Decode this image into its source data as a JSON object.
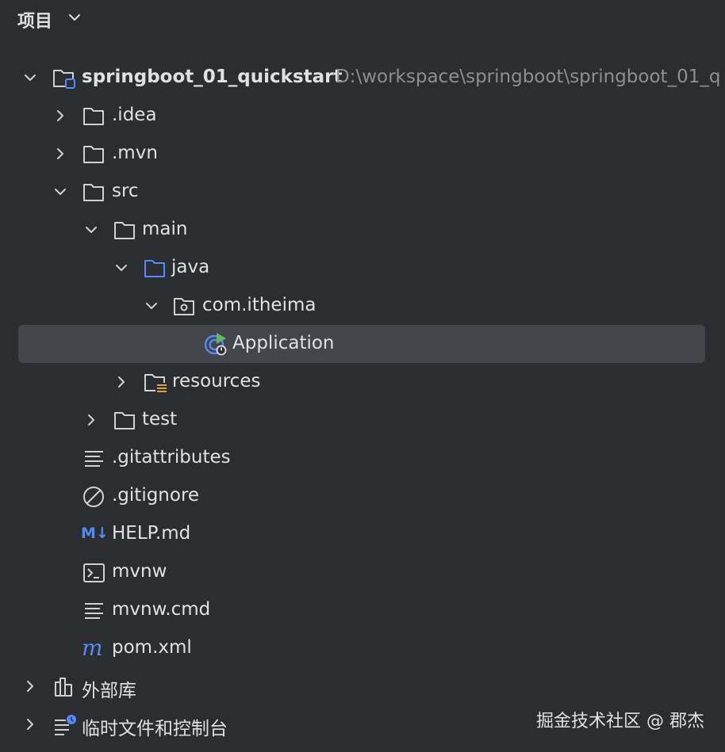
{
  "header": {
    "title": "项目"
  },
  "tree": {
    "root": {
      "label": "springboot_01_quickstart",
      "path": "D:\\workspace\\springboot\\springboot_01_q"
    },
    "items": [
      {
        "label": ".idea"
      },
      {
        "label": ".mvn"
      },
      {
        "label": "src"
      },
      {
        "label": "main"
      },
      {
        "label": "java"
      },
      {
        "label": "com.itheima"
      },
      {
        "label": "Application"
      },
      {
        "label": "resources"
      },
      {
        "label": "test"
      },
      {
        "label": ".gitattributes"
      },
      {
        "label": ".gitignore"
      },
      {
        "label": "HELP.md"
      },
      {
        "label": "mvnw"
      },
      {
        "label": "mvnw.cmd"
      },
      {
        "label": "pom.xml"
      },
      {
        "label": "外部库"
      },
      {
        "label": "临时文件和控制台"
      }
    ],
    "md_badge": "M↓"
  },
  "watermark": "掘金技术社区 @ 郡杰",
  "colors": {
    "background": "#2b2d30",
    "selection": "#43454a",
    "text": "#dfe1e5",
    "muted": "#8c8f94",
    "accent": "#548af7",
    "run_green": "#5fb865",
    "resources_yellow": "#d9a343"
  }
}
